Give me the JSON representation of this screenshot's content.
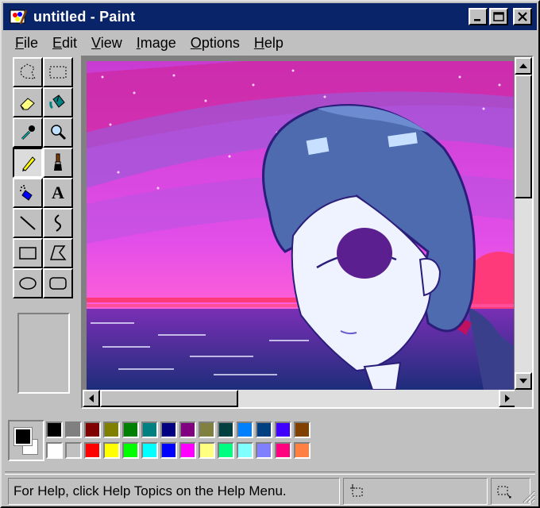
{
  "window": {
    "title": "untitled - Paint"
  },
  "title_buttons": [
    {
      "name": "minimize-button",
      "icon": "minimize-icon"
    },
    {
      "name": "maximize-button",
      "icon": "maximize-icon"
    },
    {
      "name": "close-button",
      "icon": "close-icon"
    }
  ],
  "menu": [
    {
      "first": "F",
      "rest": "ile"
    },
    {
      "first": "E",
      "rest": "dit"
    },
    {
      "first": "V",
      "rest": "iew"
    },
    {
      "first": "I",
      "rest": "mage"
    },
    {
      "first": "O",
      "rest": "ptions"
    },
    {
      "first": "H",
      "rest": "elp"
    }
  ],
  "tools": [
    {
      "name": "free-form-select",
      "icon": "free-form-select-icon"
    },
    {
      "name": "select",
      "icon": "rect-select-icon"
    },
    {
      "name": "eraser",
      "icon": "eraser-icon"
    },
    {
      "name": "fill-with-color",
      "icon": "paint-bucket-icon"
    },
    {
      "name": "pick-color",
      "icon": "eyedropper-icon"
    },
    {
      "name": "magnifier",
      "icon": "magnifier-icon"
    },
    {
      "name": "pencil",
      "icon": "pencil-icon",
      "selected": true
    },
    {
      "name": "brush",
      "icon": "brush-icon"
    },
    {
      "name": "airbrush",
      "icon": "airbrush-icon"
    },
    {
      "name": "text",
      "icon": "text-icon",
      "glyph": "A"
    },
    {
      "name": "line",
      "icon": "line-icon"
    },
    {
      "name": "curve",
      "icon": "curve-icon"
    },
    {
      "name": "rectangle",
      "icon": "rectangle-icon"
    },
    {
      "name": "polygon",
      "icon": "polygon-icon"
    },
    {
      "name": "ellipse",
      "icon": "ellipse-icon"
    },
    {
      "name": "rounded-rectangle",
      "icon": "rounded-rectangle-icon"
    }
  ],
  "colors": {
    "foreground": "#000000",
    "background": "#ffffff",
    "palette_top": [
      "#000000",
      "#808080",
      "#800000",
      "#808000",
      "#008000",
      "#008080",
      "#000080",
      "#800080",
      "#808040",
      "#004040",
      "#0080ff",
      "#004080",
      "#4000ff",
      "#804000"
    ],
    "palette_bottom": [
      "#ffffff",
      "#c0c0c0",
      "#ff0000",
      "#ffff00",
      "#00ff00",
      "#00ffff",
      "#0000ff",
      "#ff00ff",
      "#ffff80",
      "#00ff80",
      "#80ffff",
      "#8080ff",
      "#ff0080",
      "#ff8040"
    ],
    "title_bar": "#0a246a",
    "face": "#c0c0c0"
  },
  "canvas": {
    "image": "anime-girl-vaporwave-painting"
  },
  "status": {
    "help_text": "For Help, click Help Topics on the Help Menu.",
    "position_icon": "cursor-position-icon",
    "size_icon": "selection-size-icon"
  }
}
